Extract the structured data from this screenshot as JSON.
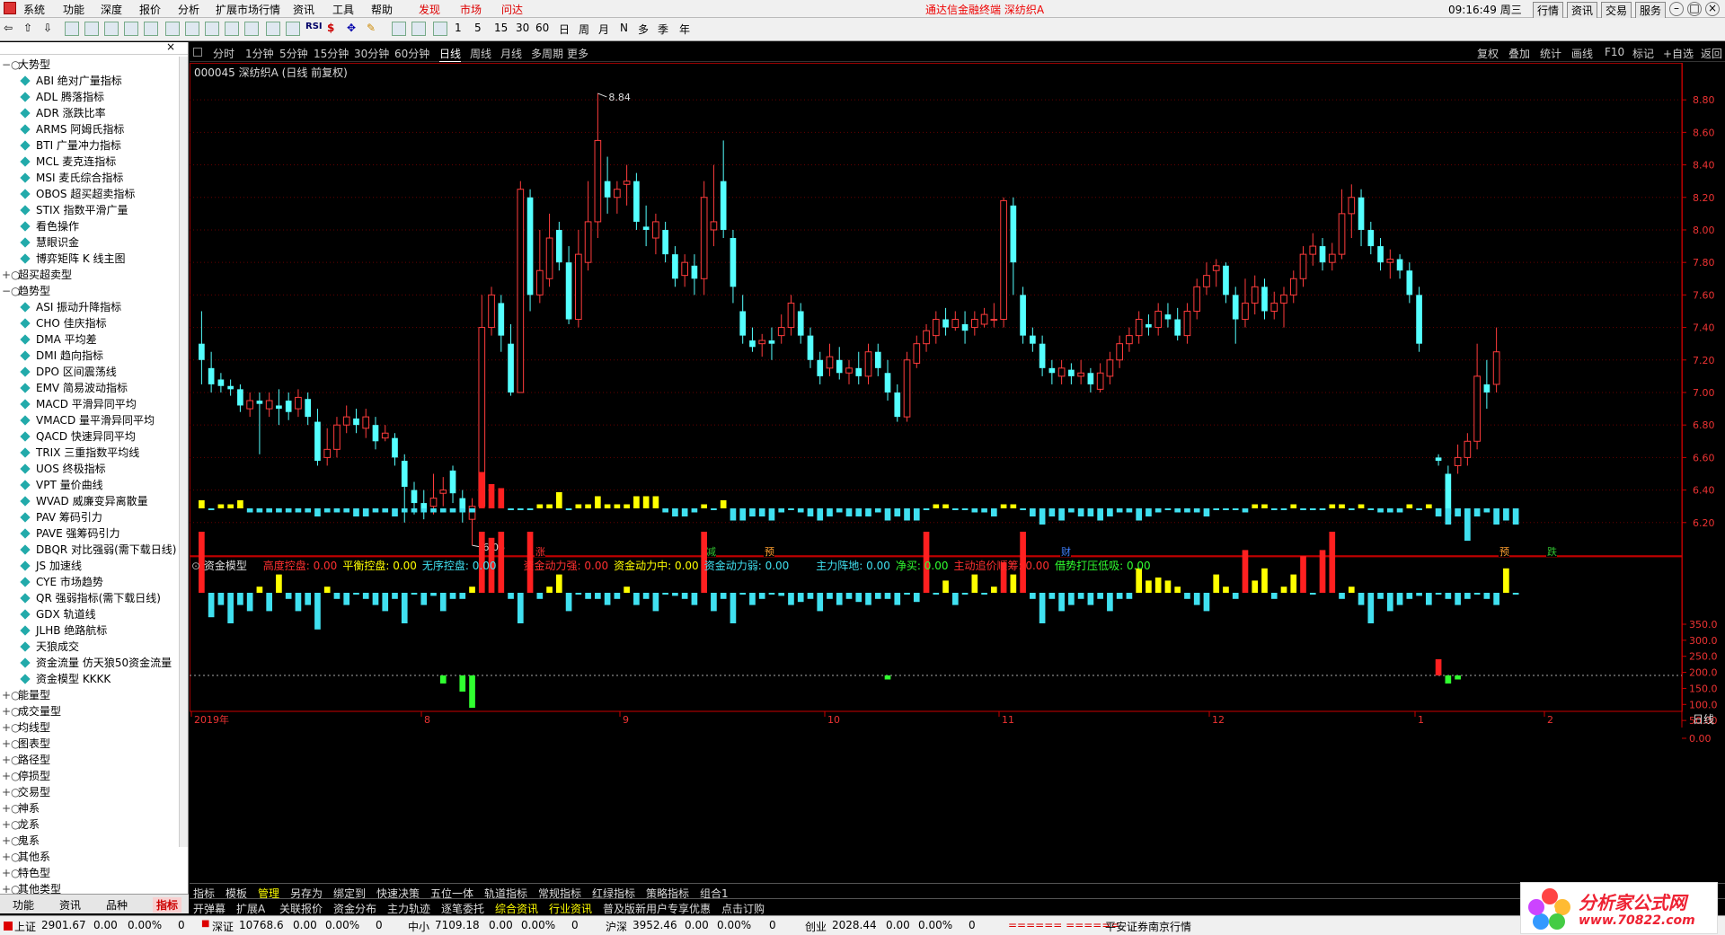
{
  "menu": [
    "系统",
    "功能",
    "深度",
    "报价",
    "分析",
    "扩展市场行情",
    "资讯",
    "工具",
    "帮助"
  ],
  "menu_red": [
    "发现",
    "市场",
    "问达"
  ],
  "ticker": "通达信金融终端  深纺织A",
  "clock": "09:16:49 周三",
  "win_buttons": [
    "行情",
    "资讯",
    "交易",
    "服务"
  ],
  "toolbar_periods": [
    "1",
    "5",
    "15",
    "30",
    "60",
    "日",
    "周",
    "月",
    "N",
    "多",
    "季",
    "年"
  ],
  "sidebar": {
    "groups": [
      {
        "label": "大势型",
        "open": true,
        "items": [
          "ABI 绝对广量指标",
          "ADL 腾落指标",
          "ADR 涨跌比率",
          "ARMS 阿姆氏指标",
          "BTI 广量冲力指标",
          "MCL 麦克连指标",
          "MSI 麦氏综合指标",
          "OBOS 超买超卖指标",
          "STIX 指数平滑广量",
          "看色操作",
          "慧眼识金",
          "博弈矩阵 K 线主图"
        ]
      },
      {
        "label": "超买超卖型",
        "open": false,
        "items": []
      },
      {
        "label": "趋势型",
        "open": true,
        "items": [
          "ASI 振动升降指标",
          "CHO 佳庆指标",
          "DMA 平均差",
          "DMI 趋向指标",
          "DPO 区间震荡线",
          "EMV 简易波动指标",
          "MACD 平滑异同平均",
          "VMACD 量平滑异同平均",
          "QACD 快速异同平均",
          "TRIX 三重指数平均线",
          "UOS 终极指标",
          "VPT 量价曲线",
          "WVAD 威廉变异离散量",
          "PAV 筹码引力",
          "PAVE 强筹码引力",
          "DBQR 对比强弱(需下载日线)",
          "JS 加速线",
          "CYE 市场趋势",
          "QR 强弱指标(需下载日线)",
          "GDX 轨道线",
          "JLHB 绝路航标",
          "天狼成交",
          "资金流量 仿天狼50资金流量",
          "资金模型 KKKK"
        ]
      },
      {
        "label": "能量型",
        "open": false,
        "items": []
      },
      {
        "label": "成交量型",
        "open": false,
        "items": []
      },
      {
        "label": "均线型",
        "open": false,
        "items": []
      },
      {
        "label": "图表型",
        "open": false,
        "items": []
      },
      {
        "label": "路径型",
        "open": false,
        "items": []
      },
      {
        "label": "停损型",
        "open": false,
        "items": []
      },
      {
        "label": "交易型",
        "open": false,
        "items": []
      },
      {
        "label": "神系",
        "open": false,
        "items": []
      },
      {
        "label": "龙系",
        "open": false,
        "items": []
      },
      {
        "label": "鬼系",
        "open": false,
        "items": []
      },
      {
        "label": "其他系",
        "open": false,
        "items": []
      },
      {
        "label": "特色型",
        "open": false,
        "items": []
      },
      {
        "label": "其他类型",
        "open": false,
        "items": []
      }
    ],
    "tabs": [
      "功能",
      "资讯",
      "品种",
      "指标"
    ],
    "active_tab": "指标"
  },
  "periods": [
    "分时",
    "1分钟",
    "5分钟",
    "15分钟",
    "30分钟",
    "60分钟",
    "日线",
    "周线",
    "月线",
    "多周期",
    "更多"
  ],
  "active_period": "日线",
  "right_tools": [
    "复权",
    "叠加",
    "统计",
    "画线",
    "F10",
    "标记",
    "+自选",
    "返回"
  ],
  "stock_title": "000045 深纺织A (日线 前复权)",
  "indicator_title": "资金模型",
  "indicator_fields": [
    {
      "label": "高度控盘:",
      "value": "0.00",
      "color": "#ff3030"
    },
    {
      "label": "平衡控盘:",
      "value": "0.00",
      "color": "#ffff00"
    },
    {
      "label": "无序控盘:",
      "value": "0.00",
      "color": "#40e0f0"
    },
    {
      "label": "资金动力强:",
      "value": "0.00",
      "color": "#ff3030"
    },
    {
      "label": "资金动力中:",
      "value": "0.00",
      "color": "#ffff00"
    },
    {
      "label": "资金动力弱:",
      "value": "0.00",
      "color": "#40e0f0"
    },
    {
      "label": "主力阵地:",
      "value": "0.00",
      "color": "#40e0f0"
    },
    {
      "label": "净买:",
      "value": "0.00",
      "color": "#30ff30"
    },
    {
      "label": "主动追价顺筹:",
      "value": "0.00",
      "color": "#ff3030"
    },
    {
      "label": "借势打压低吸:",
      "value": "0.00",
      "color": "#30ff30"
    }
  ],
  "price_axis": [
    "8.80",
    "8.60",
    "8.40",
    "8.20",
    "8.00",
    "7.80",
    "7.60",
    "7.40",
    "7.20",
    "7.00",
    "6.80",
    "6.60",
    "6.40",
    "6.20"
  ],
  "price_high_label": "8.84",
  "price_low_label": "6.06",
  "ind_axis": [
    "350.0",
    "300.0",
    "250.0",
    "200.0",
    "150.0",
    "100.0",
    "50.00",
    "0.00"
  ],
  "date_labels": [
    "2019年",
    "8",
    "9",
    "10",
    "11",
    "12",
    "1",
    "2"
  ],
  "date_right": "日线",
  "event_marks": [
    {
      "text": "涨",
      "color": "#ff3030"
    },
    {
      "text": "减",
      "color": "#30c030"
    },
    {
      "text": "预",
      "color": "#ffa030"
    },
    {
      "text": "财",
      "color": "#4080ff"
    },
    {
      "text": "预",
      "color": "#ffa030"
    },
    {
      "text": "跌",
      "color": "#30c030"
    }
  ],
  "bottom_tabs1": [
    "指标",
    "模板",
    "管理",
    "另存为",
    "绑定到",
    "快速决策",
    "五位一体",
    "轨道指标",
    "常规指标",
    "红绿指标",
    "策略指标",
    "组合1"
  ],
  "bottom_tabs2": [
    "开弹幕",
    "扩展A",
    "关联报价",
    "资金分布",
    "主力轨迹",
    "逐笔委托",
    "综合资讯",
    "行业资讯",
    "普及版新用户专享优惠",
    "点击订购"
  ],
  "status": {
    "sh": {
      "name": "上证",
      "value": "2901.67",
      "chg": "0.00",
      "pct": "0.00%",
      "vol": "0"
    },
    "sz": {
      "name": "深证",
      "value": "10768.6",
      "chg": "0.00",
      "pct": "0.00%",
      "vol": "0"
    },
    "zx": {
      "name": "中小",
      "value": "7109.18",
      "chg": "0.00",
      "pct": "0.00%",
      "vol": "0"
    },
    "hs": {
      "name": "沪深",
      "value": "3952.46",
      "chg": "0.00",
      "pct": "0.00%",
      "vol": "0"
    },
    "cy": {
      "name": "创业",
      "value": "2028.44",
      "chg": "0.00",
      "pct": "0.00%",
      "vol": "0"
    },
    "server": "平安证券南京行情",
    "marker": "====== ======"
  },
  "logo": {
    "title": "分析家公式网",
    "url": "www.70822.com"
  },
  "chart_data": {
    "type": "candlestick",
    "price_range": [
      6.0,
      8.95
    ],
    "candles": [
      [
        7.3,
        7.2,
        7.5,
        7.05
      ],
      [
        7.15,
        7.05,
        7.25,
        7.0
      ],
      [
        7.08,
        7.04,
        7.12,
        7.0
      ],
      [
        7.04,
        7.02,
        7.08,
        6.98
      ],
      [
        7.02,
        6.92,
        7.05,
        6.88
      ],
      [
        6.9,
        6.95,
        7.0,
        6.85
      ],
      [
        6.95,
        6.93,
        7.0,
        6.62
      ],
      [
        6.9,
        6.95,
        7.0,
        6.85
      ],
      [
        6.92,
        6.9,
        7.02,
        6.8
      ],
      [
        6.95,
        6.88,
        7.0,
        6.83
      ],
      [
        6.9,
        6.97,
        7.02,
        6.85
      ],
      [
        6.96,
        6.85,
        7.0,
        6.8
      ],
      [
        6.82,
        6.58,
        6.9,
        6.55
      ],
      [
        6.6,
        6.65,
        6.78,
        6.55
      ],
      [
        6.65,
        6.8,
        6.85,
        6.6
      ],
      [
        6.8,
        6.85,
        6.92,
        6.75
      ],
      [
        6.84,
        6.8,
        6.9,
        6.75
      ],
      [
        6.78,
        6.85,
        6.9,
        6.72
      ],
      [
        6.8,
        6.7,
        6.85,
        6.65
      ],
      [
        6.72,
        6.75,
        6.8,
        6.7
      ],
      [
        6.72,
        6.6,
        6.75,
        6.55
      ],
      [
        6.58,
        6.42,
        6.62,
        6.2
      ],
      [
        6.4,
        6.32,
        6.45,
        6.25
      ],
      [
        6.32,
        6.28,
        6.4,
        6.22
      ],
      [
        6.3,
        6.35,
        6.5,
        6.25
      ],
      [
        6.38,
        6.4,
        6.48,
        6.3
      ],
      [
        6.52,
        6.38,
        6.55,
        6.32
      ],
      [
        6.35,
        6.28,
        6.4,
        6.2
      ],
      [
        6.22,
        6.3,
        6.35,
        6.06
      ],
      [
        6.3,
        7.4,
        7.6,
        7.2
      ],
      [
        7.4,
        7.6,
        7.65,
        7.35
      ],
      [
        7.55,
        7.35,
        7.6,
        7.25
      ],
      [
        7.3,
        7.0,
        7.42,
        6.98
      ],
      [
        7.0,
        8.25,
        8.3,
        7.0
      ],
      [
        8.2,
        7.6,
        8.25,
        7.5
      ],
      [
        7.6,
        7.75,
        8.0,
        7.55
      ],
      [
        7.7,
        7.95,
        8.1,
        7.65
      ],
      [
        8.0,
        7.8,
        8.05,
        7.75
      ],
      [
        7.8,
        7.45,
        7.9,
        7.42
      ],
      [
        7.45,
        7.85,
        8.0,
        7.4
      ],
      [
        7.8,
        8.05,
        8.3,
        7.75
      ],
      [
        8.05,
        8.55,
        8.84,
        7.95
      ],
      [
        8.3,
        8.2,
        8.45,
        8.1
      ],
      [
        8.2,
        8.25,
        8.3,
        8.1
      ],
      [
        8.28,
        8.3,
        8.4,
        8.15
      ],
      [
        8.3,
        8.05,
        8.35,
        8.0
      ],
      [
        8.02,
        8.0,
        8.15,
        7.9
      ],
      [
        7.95,
        8.05,
        8.1,
        7.85
      ],
      [
        8.0,
        7.85,
        8.05,
        7.8
      ],
      [
        7.85,
        7.7,
        7.9,
        7.65
      ],
      [
        7.72,
        7.8,
        7.85,
        7.65
      ],
      [
        7.78,
        7.7,
        7.85,
        7.6
      ],
      [
        7.7,
        8.2,
        8.3,
        7.6
      ],
      [
        8.0,
        8.05,
        8.4,
        7.9
      ],
      [
        8.3,
        8.0,
        8.55,
        7.95
      ],
      [
        7.95,
        7.65,
        8.0,
        7.55
      ],
      [
        7.5,
        7.35,
        7.6,
        7.3
      ],
      [
        7.32,
        7.28,
        7.4,
        7.25
      ],
      [
        7.3,
        7.32,
        7.36,
        7.22
      ],
      [
        7.32,
        7.3,
        7.4,
        7.2
      ],
      [
        7.35,
        7.4,
        7.48,
        7.3
      ],
      [
        7.4,
        7.55,
        7.6,
        7.35
      ],
      [
        7.5,
        7.35,
        7.55,
        7.3
      ],
      [
        7.35,
        7.2,
        7.4,
        7.15
      ],
      [
        7.2,
        7.1,
        7.25,
        7.05
      ],
      [
        7.15,
        7.22,
        7.3,
        7.1
      ],
      [
        7.2,
        7.12,
        7.28,
        7.08
      ],
      [
        7.12,
        7.15,
        7.2,
        7.05
      ],
      [
        7.15,
        7.1,
        7.25,
        7.05
      ],
      [
        7.1,
        7.25,
        7.3,
        7.05
      ],
      [
        7.25,
        7.15,
        7.3,
        7.1
      ],
      [
        7.12,
        7.0,
        7.2,
        6.95
      ],
      [
        7.0,
        6.85,
        7.05,
        6.82
      ],
      [
        6.85,
        7.2,
        7.25,
        6.82
      ],
      [
        7.18,
        7.3,
        7.35,
        7.15
      ],
      [
        7.3,
        7.38,
        7.42,
        7.25
      ],
      [
        7.35,
        7.45,
        7.5,
        7.3
      ],
      [
        7.45,
        7.4,
        7.52,
        7.35
      ],
      [
        7.4,
        7.45,
        7.5,
        7.38
      ],
      [
        7.42,
        7.38,
        7.5,
        7.3
      ],
      [
        7.4,
        7.45,
        7.5,
        7.35
      ],
      [
        7.42,
        7.48,
        7.52,
        7.4
      ],
      [
        7.45,
        7.45,
        7.55,
        7.4
      ],
      [
        7.45,
        8.18,
        8.2,
        7.4
      ],
      [
        8.15,
        7.8,
        8.2,
        7.6
      ],
      [
        7.6,
        7.35,
        7.65,
        7.3
      ],
      [
        7.35,
        7.3,
        7.4,
        7.25
      ],
      [
        7.3,
        7.15,
        7.35,
        7.1
      ],
      [
        7.15,
        7.12,
        7.2,
        7.05
      ],
      [
        7.1,
        7.15,
        7.2,
        7.05
      ],
      [
        7.14,
        7.1,
        7.18,
        7.05
      ],
      [
        7.1,
        7.12,
        7.2,
        7.05
      ],
      [
        7.12,
        7.05,
        7.15,
        7.0
      ],
      [
        7.02,
        7.12,
        7.18,
        7.0
      ],
      [
        7.1,
        7.2,
        7.25,
        7.05
      ],
      [
        7.2,
        7.3,
        7.35,
        7.15
      ],
      [
        7.3,
        7.35,
        7.4,
        7.25
      ],
      [
        7.35,
        7.45,
        7.5,
        7.3
      ],
      [
        7.42,
        7.4,
        7.48,
        7.35
      ],
      [
        7.4,
        7.5,
        7.55,
        7.35
      ],
      [
        7.48,
        7.45,
        7.55,
        7.4
      ],
      [
        7.45,
        7.35,
        7.52,
        7.32
      ],
      [
        7.35,
        7.5,
        7.55,
        7.3
      ],
      [
        7.5,
        7.65,
        7.7,
        7.45
      ],
      [
        7.65,
        7.72,
        7.8,
        7.6
      ],
      [
        7.75,
        7.78,
        7.82,
        7.65
      ],
      [
        7.78,
        7.6,
        7.8,
        7.55
      ],
      [
        7.6,
        7.45,
        7.65,
        7.3
      ],
      [
        7.45,
        7.55,
        7.7,
        7.4
      ],
      [
        7.55,
        7.65,
        7.72,
        7.48
      ],
      [
        7.65,
        7.5,
        7.7,
        7.45
      ],
      [
        7.5,
        7.55,
        7.62,
        7.45
      ],
      [
        7.55,
        7.6,
        7.65,
        7.4
      ],
      [
        7.6,
        7.7,
        7.75,
        7.55
      ],
      [
        7.7,
        7.85,
        7.9,
        7.65
      ],
      [
        7.85,
        7.9,
        7.98,
        7.78
      ],
      [
        7.9,
        7.8,
        7.95,
        7.75
      ],
      [
        7.8,
        7.85,
        7.92,
        7.75
      ],
      [
        7.85,
        8.1,
        8.25,
        7.82
      ],
      [
        8.1,
        8.2,
        8.28,
        7.95
      ],
      [
        8.2,
        8.0,
        8.25,
        7.9
      ],
      [
        8.0,
        7.9,
        8.05,
        7.85
      ],
      [
        7.9,
        7.8,
        7.95,
        7.75
      ],
      [
        7.8,
        7.82,
        7.88,
        7.7
      ],
      [
        7.82,
        7.75,
        7.85,
        7.7
      ],
      [
        7.75,
        7.6,
        7.8,
        7.55
      ],
      [
        7.6,
        7.3,
        7.65,
        7.25
      ],
      [
        null,
        null,
        null,
        null
      ],
      [
        6.6,
        6.58,
        6.62,
        6.55
      ],
      [
        6.5,
        6.25,
        6.55,
        6.25
      ],
      [
        6.55,
        6.6,
        6.68,
        6.5
      ],
      [
        6.6,
        6.7,
        6.75,
        6.55
      ],
      [
        6.7,
        7.1,
        7.3,
        6.65
      ],
      [
        7.05,
        7.0,
        7.2,
        6.9
      ],
      [
        7.05,
        7.25,
        7.4,
        7.0
      ]
    ],
    "indicator_range": [
      -20,
      380
    ],
    "indicator_upper": [
      310,
      300,
      305,
      305,
      310,
      295,
      295,
      295,
      295,
      295,
      295,
      295,
      290,
      295,
      295,
      295,
      290,
      290,
      295,
      295,
      290,
      295,
      295,
      295,
      295,
      295,
      295,
      295,
      295,
      345,
      330,
      325,
      300,
      300,
      300,
      305,
      305,
      320,
      300,
      305,
      305,
      315,
      305,
      305,
      305,
      315,
      315,
      315,
      295,
      290,
      290,
      295,
      305,
      300,
      310,
      285,
      285,
      290,
      290,
      285,
      295,
      300,
      295,
      290,
      285,
      290,
      295,
      290,
      290,
      290,
      295,
      285,
      290,
      285,
      285,
      300,
      305,
      305,
      300,
      300,
      295,
      295,
      290,
      305,
      305,
      300,
      290,
      280,
      290,
      285,
      295,
      290,
      290,
      285,
      290,
      295,
      295,
      285,
      290,
      295,
      300,
      295,
      295,
      295,
      290,
      300,
      300,
      300,
      295,
      305,
      305,
      300,
      300,
      305,
      300,
      300,
      300,
      305,
      305,
      300,
      305,
      300,
      295,
      295,
      295,
      305,
      300,
      305,
      290,
      280,
      290,
      260,
      290,
      295,
      280,
      285,
      280
    ],
    "indicator_mid": [
      250,
      110,
      130,
      100,
      130,
      120,
      160,
      120,
      180,
      140,
      120,
      130,
      90,
      160,
      140,
      130,
      150,
      140,
      130,
      120,
      140,
      100,
      150,
      130,
      145,
      120,
      140,
      140,
      160,
      250,
      240,
      250,
      140,
      100,
      250,
      140,
      160,
      180,
      120,
      150,
      140,
      140,
      130,
      140,
      160,
      130,
      140,
      120,
      150,
      145,
      140,
      130,
      250,
      120,
      140,
      100,
      150,
      130,
      140,
      150,
      145,
      130,
      135,
      140,
      120,
      140,
      130,
      140,
      135,
      130,
      140,
      140,
      130,
      150,
      135,
      250,
      150,
      170,
      130,
      150,
      180,
      150,
      160,
      200,
      180,
      250,
      140,
      100,
      140,
      120,
      130,
      140,
      130,
      140,
      120,
      140,
      140,
      190,
      170,
      175,
      170,
      160,
      140,
      130,
      120,
      180,
      160,
      140,
      220,
      170,
      190,
      140,
      160,
      180,
      210,
      150,
      220,
      250,
      140,
      160,
      130,
      100,
      140,
      120,
      130,
      140,
      145,
      130,
      150,
      140,
      130,
      140,
      150,
      140,
      130,
      190,
      150
    ],
    "indicator_low": [
      0,
      0,
      0,
      0,
      0,
      0,
      0,
      0,
      0,
      0,
      0,
      0,
      0,
      0,
      0,
      0,
      0,
      0,
      0,
      0,
      0,
      0,
      0,
      0,
      0,
      -10,
      0,
      -20,
      -40,
      0,
      0,
      0,
      0,
      0,
      0,
      0,
      0,
      0,
      0,
      0,
      0,
      0,
      0,
      0,
      0,
      0,
      0,
      0,
      0,
      0,
      0,
      0,
      0,
      0,
      0,
      0,
      0,
      0,
      0,
      0,
      0,
      0,
      0,
      0,
      0,
      0,
      0,
      0,
      0,
      0,
      0,
      -5,
      0,
      0,
      0,
      0,
      0,
      0,
      0,
      0,
      0,
      0,
      0,
      0,
      0,
      0,
      0,
      0,
      0,
      0,
      0,
      0,
      0,
      0,
      0,
      0,
      0,
      0,
      0,
      0,
      0,
      0,
      0,
      0,
      0,
      0,
      0,
      0,
      0,
      0,
      0,
      0,
      0,
      0,
      0,
      0,
      0,
      0,
      0,
      0,
      0,
      0,
      0,
      0,
      0,
      0,
      0,
      0,
      20,
      -10,
      -5,
      0,
      0,
      0,
      0
    ]
  }
}
